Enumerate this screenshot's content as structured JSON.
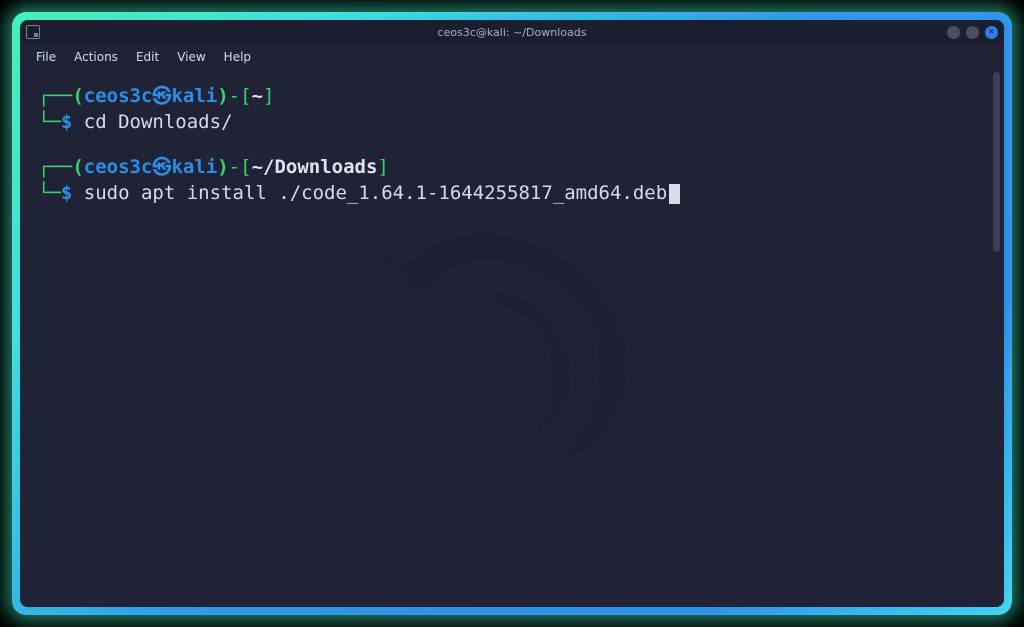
{
  "titlebar": {
    "title": "ceos3c@kali: ~/Downloads"
  },
  "menubar": {
    "items": [
      "File",
      "Actions",
      "Edit",
      "View",
      "Help"
    ]
  },
  "prompt": {
    "user": "ceos3c",
    "host": "kali",
    "skull_glyph": "㉿"
  },
  "blocks": [
    {
      "path": "~",
      "command": "cd Downloads/",
      "has_cursor": false
    },
    {
      "path": "~/Downloads",
      "command": "sudo apt install ./code_1.64.1-1644255817_amd64.deb",
      "has_cursor": true
    }
  ],
  "colors": {
    "user_host": "#2a8ee8",
    "accent_green": "#3bd36b",
    "text": "#d8dce8",
    "bg": "#1f2335"
  }
}
